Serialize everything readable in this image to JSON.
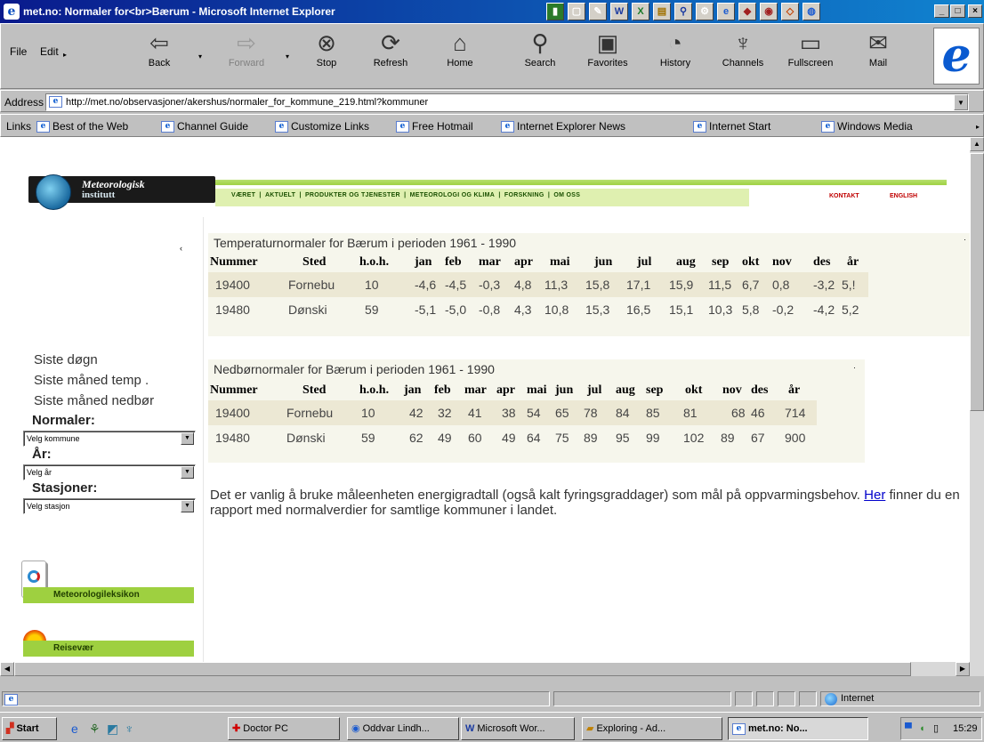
{
  "window": {
    "title": "met.no: Normaler for<br>Bærum - Microsoft Internet Explorer",
    "min": "_",
    "max": "□",
    "close": "×"
  },
  "menu": [
    "File",
    "Edit"
  ],
  "toolbar": [
    {
      "label": "Back",
      "icon": "back-arrow-icon",
      "enabled": true
    },
    {
      "label": "Forward",
      "icon": "forward-arrow-icon",
      "enabled": false
    },
    {
      "label": "Stop",
      "icon": "stop-icon",
      "enabled": true
    },
    {
      "label": "Refresh",
      "icon": "refresh-icon",
      "enabled": true
    },
    {
      "label": "Home",
      "icon": "home-icon",
      "enabled": true
    },
    {
      "label": "Search",
      "icon": "search-icon",
      "enabled": true
    },
    {
      "label": "Favorites",
      "icon": "favorites-icon",
      "enabled": true
    },
    {
      "label": "History",
      "icon": "history-icon",
      "enabled": true
    },
    {
      "label": "Channels",
      "icon": "channels-icon",
      "enabled": true
    },
    {
      "label": "Fullscreen",
      "icon": "fullscreen-icon",
      "enabled": true
    },
    {
      "label": "Mail",
      "icon": "mail-icon",
      "enabled": true
    }
  ],
  "address": {
    "label": "Address",
    "url": "http://met.no/observasjoner/akershus/normaler_for_kommune_219.html?kommuner"
  },
  "links": {
    "label": "Links",
    "items": [
      "Best of the Web",
      "Channel Guide",
      "Customize Links",
      "Free Hotmail",
      "Internet Explorer News",
      "Internet Start",
      "Windows Media"
    ]
  },
  "site": {
    "logo_line1": "Meteorologisk",
    "logo_line2": "institutt",
    "nav": [
      "VÆRET",
      "AKTUELT",
      "PRODUKTER OG TJENESTER",
      "METEOROLOGI OG KLIMA",
      "FORSKNING",
      "OM OSS"
    ],
    "nav_sep": "|",
    "kontakt": "KONTAKT",
    "english": "ENGLISH"
  },
  "sidebar": {
    "links": [
      "Siste døgn",
      "Siste måned temp .",
      "Siste måned nedbør"
    ],
    "normaler_label": "Normaler:",
    "kommune_select": "Velg kommune",
    "ar_label": "År:",
    "ar_select": "Velg år",
    "stasjoner_label": "Stasjoner:",
    "stasjon_select": "Velg stasjon",
    "banner1": "Meteorologileksikon",
    "banner2": "Reisevær"
  },
  "temp_table": {
    "caption": "Temperaturnormaler for Bærum i perioden 1961 - 1990",
    "headers": [
      "Nummer",
      "Sted",
      "h.o.h.",
      "jan",
      "feb",
      "mar",
      "apr",
      "mai",
      "jun",
      "jul",
      "aug",
      "sep",
      "okt",
      "nov",
      "des",
      "år"
    ],
    "rows": [
      [
        "19400",
        "Fornebu",
        "10",
        "-4,6",
        "-4,5",
        "-0,3",
        "4,8",
        "11,3",
        "15,8",
        "17,1",
        "15,9",
        "11,5",
        "6,7",
        "0,8",
        "-3,2",
        "5,!"
      ],
      [
        "19480",
        "Dønski",
        "59",
        "-5,1",
        "-5,0",
        "-0,8",
        "4,3",
        "10,8",
        "15,3",
        "16,5",
        "15,1",
        "10,3",
        "5,8",
        "-0,2",
        "-4,2",
        "5,2"
      ]
    ]
  },
  "precip_table": {
    "caption": "Nedbørnormaler for Bærum i perioden 1961 - 1990",
    "headers": [
      "Nummer",
      "Sted",
      "h.o.h.",
      "jan",
      "feb",
      "mar",
      "apr",
      "mai",
      "jun",
      "jul",
      "aug",
      "sep",
      "okt",
      "nov",
      "des",
      "år"
    ],
    "rows": [
      [
        "19400",
        "Fornebu",
        "10",
        "42",
        "32",
        "41",
        "38",
        "54",
        "65",
        "78",
        "84",
        "85",
        "81",
        "68",
        "46",
        "714"
      ],
      [
        "19480",
        "Dønski",
        "59",
        "62",
        "49",
        "60",
        "49",
        "64",
        "75",
        "89",
        "95",
        "99",
        "102",
        "89",
        "67",
        "900"
      ]
    ]
  },
  "note": {
    "before": "Det er vanlig å bruke måleenheten energigradtall (også kalt fyringsgraddager) som mål på oppvarmingsbehov.",
    "link": "Her",
    "after": "finner du en rapport med normalverdier for samtlige kommuner i landet."
  },
  "status": {
    "zone": "Internet"
  },
  "taskbar": {
    "start": "Start",
    "tasks": [
      "Doctor PC",
      "Oddvar Lindh...",
      "Microsoft Wor...",
      "Exploring - Ad...",
      "met.no: No..."
    ],
    "time": "15:29"
  },
  "colors": {
    "titlebar": "#0a1a8c",
    "site_green": "#9ed040",
    "table_bg": "#f6f6ec",
    "link": "#0000cc"
  }
}
